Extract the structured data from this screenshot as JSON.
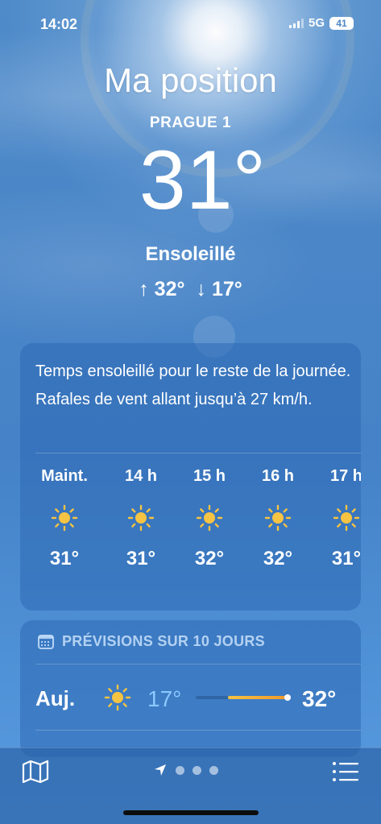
{
  "status_bar": {
    "time": "14:02",
    "network": "5G",
    "battery": "41"
  },
  "header": {
    "title": "Ma position",
    "subtitle": "PRAGUE 1",
    "temperature": "31°",
    "condition": "Ensoleillé",
    "high": "↑ 32°",
    "low": "↓ 17°"
  },
  "hourly": {
    "summary": "Temps ensoleillé pour le reste de la journée. Rafales de vent allant jusqu’à 27 km/h.",
    "items": [
      {
        "label": "Maint.",
        "icon": "sun-icon",
        "temp": "31°"
      },
      {
        "label": "14 h",
        "icon": "sun-icon",
        "temp": "31°"
      },
      {
        "label": "15 h",
        "icon": "sun-icon",
        "temp": "32°"
      },
      {
        "label": "16 h",
        "icon": "sun-icon",
        "temp": "32°"
      },
      {
        "label": "17 h",
        "icon": "sun-icon",
        "temp": "31°"
      }
    ]
  },
  "forecast": {
    "header": "PRÉVISIONS SUR 10 JOURS",
    "header_icon": "calendar-icon",
    "days": [
      {
        "day": "Auj.",
        "icon": "sun-icon",
        "low": "17°",
        "high": "32°"
      }
    ]
  },
  "bottom_bar": {
    "left_icon": "map-icon",
    "center_icon": "location-arrow-icon",
    "right_icon": "list-icon",
    "page_count": 4
  },
  "colors": {
    "sky": "#4a86c8",
    "sun": "#f6c343",
    "low_temp": "#8cc8ff"
  }
}
